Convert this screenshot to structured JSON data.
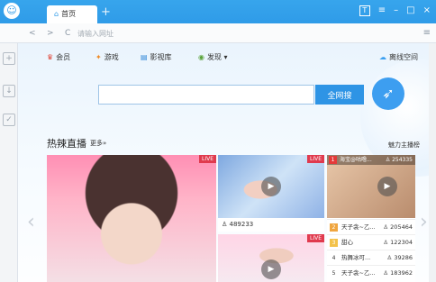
{
  "titlebar": {
    "logo": "☺",
    "tab_icon": "⌂",
    "tab_label": "首页",
    "new_tab": "+",
    "skin_icon": "T",
    "controls": [
      "≡",
      "–",
      "□",
      "×"
    ]
  },
  "addrbar": {
    "back": "<",
    "forward": ">",
    "refresh": "C",
    "placeholder": "请输入网址",
    "menu": "≡"
  },
  "sidebar": {
    "icons": [
      "+",
      "↓",
      "✓"
    ]
  },
  "nav": {
    "items": [
      {
        "icon": "♛",
        "label": "会员",
        "color": "#e0483b"
      },
      {
        "icon": "✦",
        "label": "游戏",
        "color": "#ef8a25"
      },
      {
        "icon": "▤",
        "label": "影视库",
        "color": "#2f86d8"
      },
      {
        "icon": "◉",
        "label": "发现 ▾",
        "color": "#5aa33b"
      }
    ],
    "cloud_icon": "☁",
    "cloud_label": "离线空间"
  },
  "search": {
    "placeholder": "",
    "button": "全网搜",
    "bird": "➶"
  },
  "hot": {
    "title": "热辣直播",
    "more": "更多»",
    "charm": "魅力主播榜"
  },
  "live_badge": "LIVE",
  "play": "▶",
  "cards": {
    "b_count": "489233"
  },
  "ranking": {
    "header": {
      "rank": "1",
      "name": "海宝@咕噜...",
      "count": "254335"
    },
    "rows": [
      {
        "rank": "2",
        "title": "天子衾~乙...",
        "count": "205464",
        "rank_color": "#f0a640"
      },
      {
        "rank": "3",
        "title": "甜心",
        "count": "122304",
        "rank_color": "#f3c24a"
      },
      {
        "rank": "4",
        "title": "热舞冰可...",
        "count": "39286",
        "rank_color": "#ffffff"
      },
      {
        "rank": "5",
        "title": "天子衾~乙...",
        "count": "183962",
        "rank_color": "#ffffff"
      }
    ]
  },
  "arrows": {
    "left": "‹",
    "right": "›"
  }
}
